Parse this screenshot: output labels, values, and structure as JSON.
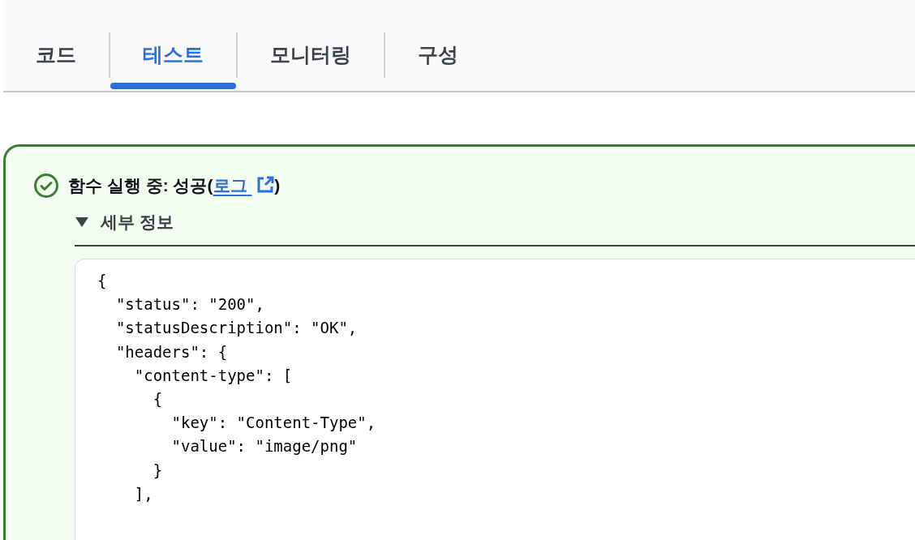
{
  "tabs": [
    {
      "label": "코드",
      "selected": false
    },
    {
      "label": "테스트",
      "selected": true
    },
    {
      "label": "모니터링",
      "selected": false
    },
    {
      "label": "구성",
      "selected": false
    }
  ],
  "result": {
    "kind": "success",
    "title_before": "함수 실행 중: 성공(",
    "link": "로그",
    "title_after": ")"
  },
  "details": {
    "label": "세부 정보",
    "expanded": true,
    "code_lines": [
      "{",
      "  \"status\": \"200\",",
      "  \"statusDescription\": \"OK\",",
      "  \"headers\": {",
      "    \"content-type\": [",
      "      {",
      "        \"key\": \"Content-Type\",",
      "        \"value\": \"image/png\"",
      "      }",
      "    ],"
    ]
  }
}
